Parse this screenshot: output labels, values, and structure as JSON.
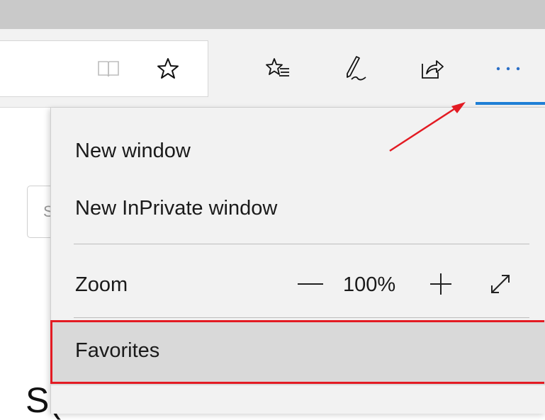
{
  "menu": {
    "new_window": "New window",
    "new_inprivate_window": "New InPrivate window",
    "zoom_label": "Zoom",
    "zoom_value": "100%",
    "favorites": "Favorites"
  },
  "page": {
    "search_fragment": "S",
    "heading_fragment": "S("
  },
  "icons": {
    "reading_view": "book-icon",
    "favorite_star": "star-icon",
    "hub": "favorites-list-icon",
    "web_note": "pen-icon",
    "share": "share-icon",
    "more": "ellipsis-icon",
    "zoom_out": "minus-icon",
    "zoom_in": "plus-icon",
    "full_screen": "expand-icon"
  },
  "colors": {
    "accent": "#1f7fd6",
    "highlight": "#e31b23"
  }
}
